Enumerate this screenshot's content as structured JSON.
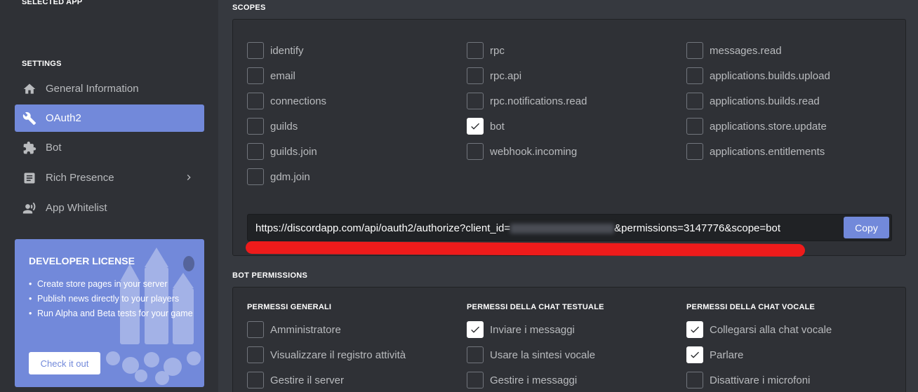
{
  "sidebar": {
    "selected_app_heading": "SELECTED APP",
    "settings_heading": "SETTINGS",
    "items": [
      {
        "label": "General Information",
        "icon": "home-icon",
        "active": false
      },
      {
        "label": "OAuth2",
        "icon": "wrench-icon",
        "active": true
      },
      {
        "label": "Bot",
        "icon": "puzzle-icon",
        "active": false
      },
      {
        "label": "Rich Presence",
        "icon": "document-icon",
        "active": false,
        "has_chevron": true
      },
      {
        "label": "App Whitelist",
        "icon": "person-phone-icon",
        "active": false
      }
    ],
    "license": {
      "title": "DEVELOPER LICENSE",
      "bullets": [
        "Create store pages in your server",
        "Publish news directly to your players",
        "Run Alpha and Beta tests for your game"
      ],
      "button": "Check it out"
    }
  },
  "scopes": {
    "heading": "SCOPES",
    "columns": [
      [
        {
          "label": "identify",
          "checked": false
        },
        {
          "label": "email",
          "checked": false
        },
        {
          "label": "connections",
          "checked": false
        },
        {
          "label": "guilds",
          "checked": false
        },
        {
          "label": "guilds.join",
          "checked": false
        },
        {
          "label": "gdm.join",
          "checked": false
        }
      ],
      [
        {
          "label": "rpc",
          "checked": false
        },
        {
          "label": "rpc.api",
          "checked": false
        },
        {
          "label": "rpc.notifications.read",
          "checked": false
        },
        {
          "label": "bot",
          "checked": true
        },
        {
          "label": "webhook.incoming",
          "checked": false
        }
      ],
      [
        {
          "label": "messages.read",
          "checked": false
        },
        {
          "label": "applications.builds.upload",
          "checked": false
        },
        {
          "label": "applications.builds.read",
          "checked": false
        },
        {
          "label": "applications.store.update",
          "checked": false
        },
        {
          "label": "applications.entitlements",
          "checked": false
        }
      ]
    ],
    "url_prefix": "https://discordapp.com/api/oauth2/authorize?client_id=",
    "url_suffix": "&permissions=3147776&scope=bot",
    "copy_label": "Copy"
  },
  "bot_permissions": {
    "heading": "BOT PERMISSIONS",
    "groups": [
      {
        "title": "PERMESSI GENERALI",
        "items": [
          {
            "label": "Amministratore",
            "checked": false
          },
          {
            "label": "Visualizzare il registro attività",
            "checked": false
          },
          {
            "label": "Gestire il server",
            "checked": false
          }
        ]
      },
      {
        "title": "PERMESSI DELLA CHAT TESTUALE",
        "items": [
          {
            "label": "Inviare i messaggi",
            "checked": true
          },
          {
            "label": "Usare la sintesi vocale",
            "checked": false
          },
          {
            "label": "Gestire i messaggi",
            "checked": false
          }
        ]
      },
      {
        "title": "PERMESSI DELLA CHAT VOCALE",
        "items": [
          {
            "label": "Collegarsi alla chat vocale",
            "checked": true
          },
          {
            "label": "Parlare",
            "checked": true
          },
          {
            "label": "Disattivare i microfoni",
            "checked": false
          }
        ]
      }
    ]
  },
  "colors": {
    "accent": "#7289da",
    "background": "#36393f",
    "sidebar": "#2f3136",
    "annotation": "#ee1b1b"
  }
}
